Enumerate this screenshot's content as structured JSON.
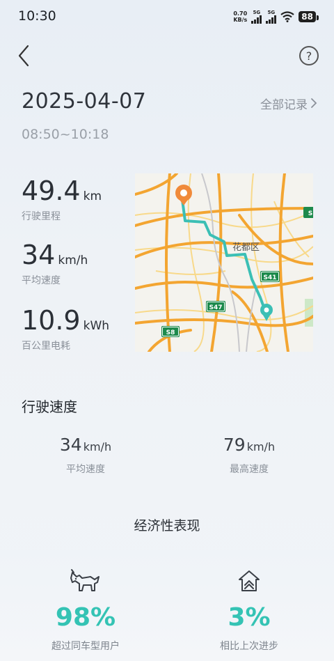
{
  "status_bar": {
    "time": "10:30",
    "net_speed_value": "0.70",
    "net_speed_unit": "KB/s",
    "sim1": "5G",
    "sim2": "5G",
    "battery": "88"
  },
  "header": {
    "back_icon": "chevron-left-icon",
    "help_icon": "question-circle-icon",
    "help_symbol": "?"
  },
  "trip": {
    "date": "2025-04-07",
    "all_records_label": "全部记录",
    "time_range": "08:50~10:18"
  },
  "stats": [
    {
      "value": "49.4",
      "unit": "km",
      "label": "行驶里程"
    },
    {
      "value": "34",
      "unit": "km/h",
      "label": "平均速度"
    },
    {
      "value": "10.9",
      "unit": "kWh",
      "label": "百公里电耗"
    }
  ],
  "map": {
    "district_label": "花都区",
    "road_badges": [
      "S41",
      "S47",
      "S8",
      "S"
    ],
    "route_color": "#3bbfb5",
    "start_color": "#f08a3a",
    "road_color": "#f3a531"
  },
  "speed_section": {
    "title": "行驶速度",
    "avg": {
      "value": "34",
      "unit": "km/h",
      "label": "平均速度"
    },
    "max": {
      "value": "79",
      "unit": "km/h",
      "label": "最高速度"
    }
  },
  "economy": {
    "title": "经济性表现",
    "left": {
      "icon": "bull-icon",
      "value": "98%",
      "label": "超过同车型用户"
    },
    "right": {
      "icon": "house-progress-icon",
      "value": "3%",
      "label": "相比上次进步"
    },
    "accent": "#34c3b4"
  }
}
